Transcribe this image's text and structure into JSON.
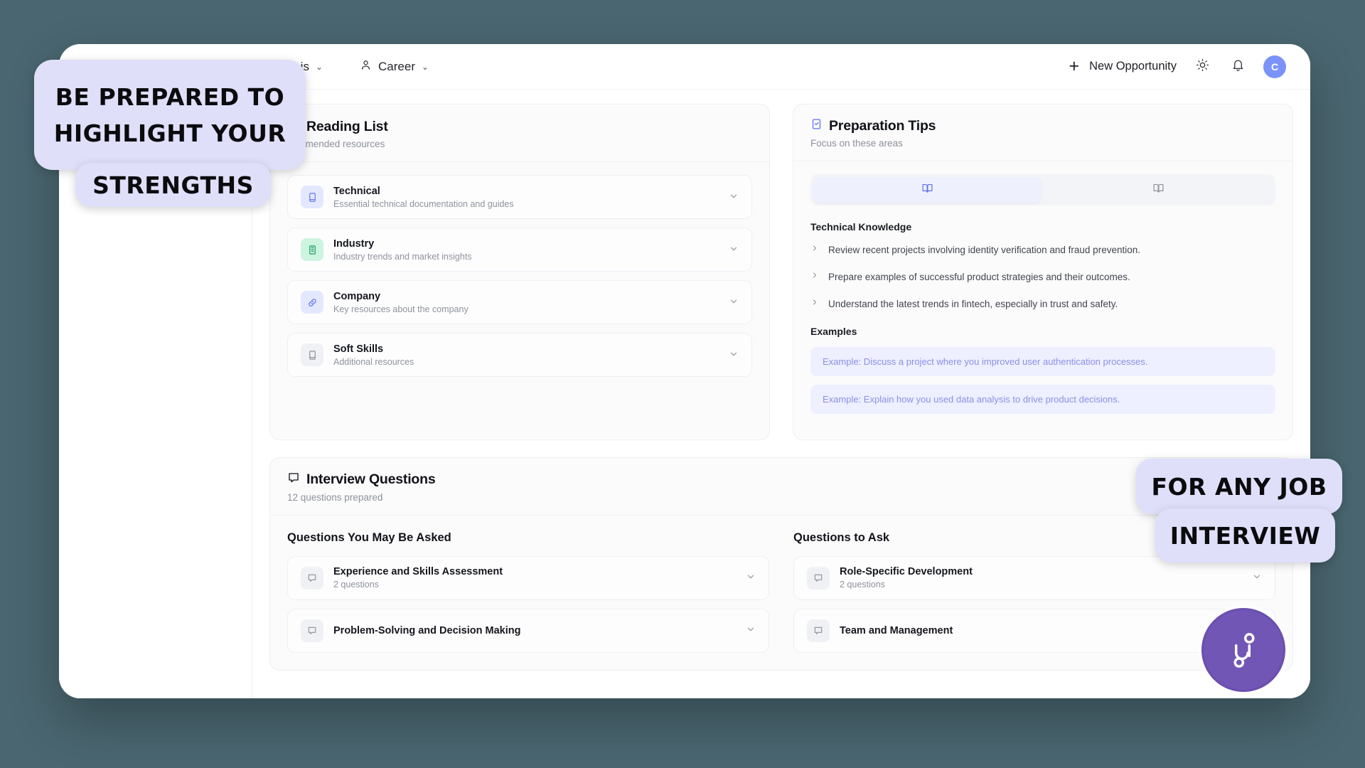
{
  "nav": {
    "analysis_label": "nalysis",
    "career_label": "Career",
    "chevron": "⌄",
    "new_opportunity_label": "New Opportunity",
    "plus_icon": "+",
    "avatar_initial": "C"
  },
  "reading_list": {
    "title": "Reading List",
    "subtitle": "commended resources",
    "items": [
      {
        "name": "Technical",
        "desc": "Essential technical documentation and guides",
        "icon": "book-icon",
        "tone": "blue"
      },
      {
        "name": "Industry",
        "desc": "Industry trends and market insights",
        "icon": "building-icon",
        "tone": "green"
      },
      {
        "name": "Company",
        "desc": "Key resources about the company",
        "icon": "link-icon",
        "tone": "blue"
      },
      {
        "name": "Soft Skills",
        "desc": "Additional resources",
        "icon": "book-icon",
        "tone": "gray"
      }
    ]
  },
  "preparation_tips": {
    "title": "Preparation Tips",
    "subtitle": "Focus on these areas",
    "tabs": [
      {
        "icon": "open-book-icon",
        "active": true
      },
      {
        "icon": "open-book-icon",
        "active": false
      }
    ],
    "section_label": "Technical Knowledge",
    "tips": [
      "Review recent projects involving identity verification and fraud prevention.",
      "Prepare examples of successful product strategies and their outcomes.",
      "Understand the latest trends in fintech, especially in trust and safety."
    ],
    "examples_label": "Examples",
    "examples": [
      "Example: Discuss a project where you improved user authentication processes.",
      "Example: Explain how you used data analysis to drive product decisions."
    ]
  },
  "interview_questions": {
    "title": "Interview Questions",
    "subtitle": "12 questions prepared",
    "left_col_title": "Questions You May Be Asked",
    "right_col_title": "Questions to Ask",
    "left_items": [
      {
        "name": "Experience and Skills Assessment",
        "count": "2 questions"
      },
      {
        "name": "Problem-Solving and Decision Making",
        "count": ""
      }
    ],
    "right_items": [
      {
        "name": "Role-Specific Development",
        "count": "2 questions"
      },
      {
        "name": "Team and Management",
        "count": ""
      }
    ]
  },
  "stickers": {
    "top_line1": "BE PREPARED TO",
    "top_line2": "HIGHLIGHT YOUR",
    "top_line3": "STRENGTHS",
    "bottom_line1": "FOR ANY JOB",
    "bottom_line2": "INTERVIEW"
  },
  "colors": {
    "backdrop": "#4a6670",
    "sticker": "#dfdffa",
    "accent": "#6070ef",
    "avatar": "#7b93f8",
    "green": "#1e9c62",
    "watermark": "#7256b6"
  }
}
